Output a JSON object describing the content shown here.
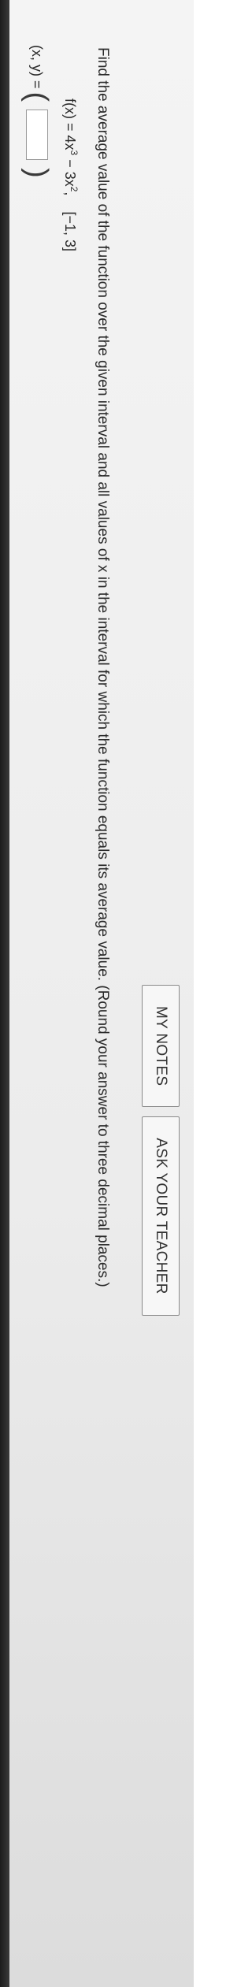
{
  "header": {
    "my_notes_label": "MY NOTES",
    "ask_teacher_label": "ASK YOUR TEACHER"
  },
  "question": {
    "prompt": "Find the average value of the function over the given interval and all values of x in the interval for which the function equals its average value. (Round your answer to three decimal places.)",
    "function_lhs": "f(x) = 4x",
    "exp1": "3",
    "function_mid": " − 3x",
    "exp2": "2",
    "function_sep": ",",
    "interval": "[−1, 3]"
  },
  "answer": {
    "label": "(x, y) =",
    "value": ""
  }
}
